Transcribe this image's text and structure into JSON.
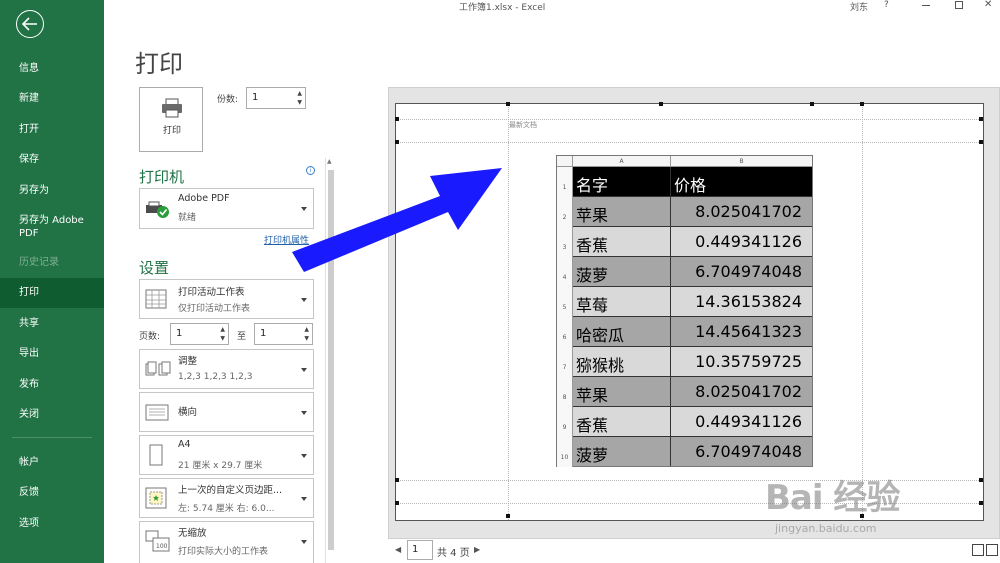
{
  "window": {
    "title": "工作簿1.xlsx  -  Excel",
    "user": "刘东",
    "help": "?",
    "close_glyph": "✕"
  },
  "nav": {
    "items": [
      {
        "label": "信息"
      },
      {
        "label": "新建"
      },
      {
        "label": "打开"
      },
      {
        "label": "保存"
      },
      {
        "label": "另存为"
      },
      {
        "label": "另存为 Adobe PDF"
      },
      {
        "label": "历史记录"
      },
      {
        "label": "打印"
      },
      {
        "label": "共享"
      },
      {
        "label": "导出"
      },
      {
        "label": "发布"
      },
      {
        "label": "关闭"
      },
      {
        "label": "帐户"
      },
      {
        "label": "反馈"
      },
      {
        "label": "选项"
      }
    ]
  },
  "print": {
    "page_title": "打印",
    "print_button_label": "打印",
    "copies_label": "份数:",
    "copies_value": "1"
  },
  "printer": {
    "heading": "打印机",
    "name": "Adobe PDF",
    "status": "就绪",
    "properties_link": "打印机属性"
  },
  "settings": {
    "heading": "设置",
    "scope": {
      "title": "打印活动工作表",
      "subtitle": "仅打印活动工作表"
    },
    "pages_label": "页数:",
    "pages_from": "1",
    "to_label": "至",
    "pages_to": "1",
    "collate": {
      "title": "调整",
      "subtitle": "1,2,3    1,2,3    1,2,3"
    },
    "orientation": {
      "title": "横向"
    },
    "paper": {
      "title": "A4",
      "subtitle": "21 厘米 x 29.7 厘米"
    },
    "margins": {
      "title": "上一次的自定义页边距...",
      "subtitle": "左: 5.74 厘米    右: 6.0..."
    },
    "scaling": {
      "title": "无缩放",
      "subtitle": "打印实际大小的工作表"
    }
  },
  "preview": {
    "header_text": "最新文档",
    "col_a": "A",
    "col_b": "B",
    "rows": [
      {
        "num": "1",
        "name": "名字",
        "price": "价格"
      },
      {
        "num": "2",
        "name": "苹果",
        "price": "8.025041702"
      },
      {
        "num": "3",
        "name": "香蕉",
        "price": "0.449341126"
      },
      {
        "num": "4",
        "name": "菠萝",
        "price": "6.704974048"
      },
      {
        "num": "5",
        "name": "草莓",
        "price": "14.36153824"
      },
      {
        "num": "6",
        "name": "哈密瓜",
        "price": "14.45641323"
      },
      {
        "num": "7",
        "name": "猕猴桃",
        "price": "10.35759725"
      },
      {
        "num": "8",
        "name": "苹果",
        "price": "8.025041702"
      },
      {
        "num": "9",
        "name": "香蕉",
        "price": "0.449341126"
      },
      {
        "num": "10",
        "name": "菠萝",
        "price": "6.704974048"
      }
    ],
    "current_page": "1",
    "total_pages": "共 4 页"
  },
  "watermark": {
    "brand": "Bai 经验",
    "url": "jingyan.baidu.com"
  },
  "colors": {
    "nav_bg": "#217346",
    "nav_active": "#0e5c2f",
    "accent_heading": "#217346",
    "arrow": "#1a1aff"
  }
}
